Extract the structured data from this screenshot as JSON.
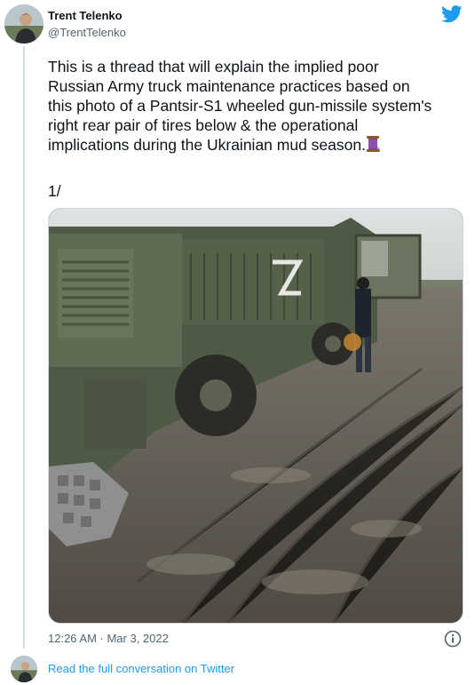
{
  "tweet": {
    "author": {
      "name": "Trent Telenko",
      "handle": "@TrentTelenko",
      "avatar_icon": "profile-photo"
    },
    "text_lines": [
      "This is a thread that will explain the implied poor",
      "Russian Army truck maintenance practices based on",
      "this photo of a Pantsir-S1 wheeled gun-missile system's",
      "right rear pair of tires below & the operational",
      "implications during the Ukrainian mud season."
    ],
    "thread_emoji": "thread-spool-emoji",
    "thread_count": "1/",
    "media": {
      "description_icon": "military-truck-in-mud-photo"
    },
    "timestamp": "12:26 AM · Mar 3, 2022",
    "info_icon": "info-icon"
  },
  "footer": {
    "read_more_label": "Read the full conversation on Twitter"
  },
  "colors": {
    "twitter_blue": "#1d9bf0",
    "text_primary": "#0f1419",
    "text_secondary": "#536471",
    "border": "#cfd9de"
  }
}
